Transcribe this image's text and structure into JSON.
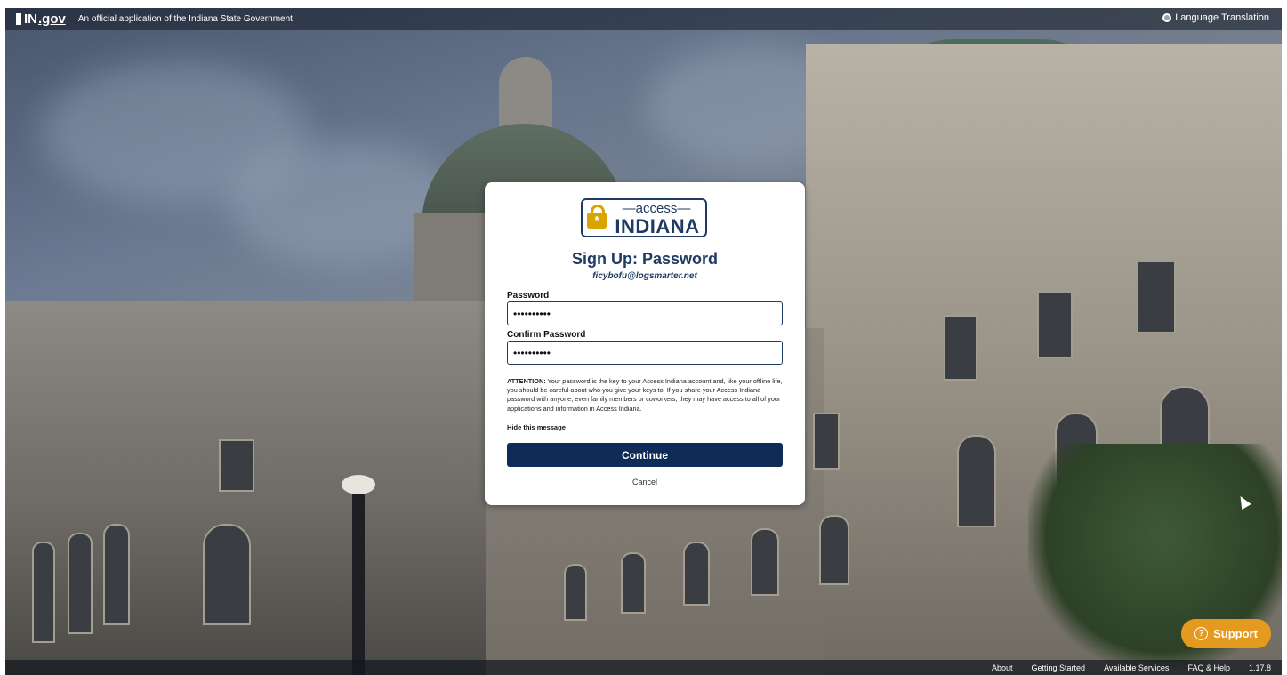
{
  "topbar": {
    "logo": "IN",
    "logo_gov": ".gov",
    "official_text": "An official application of the Indiana State Government",
    "language_label": "Language Translation",
    "language_icon": "globe-icon"
  },
  "card": {
    "brand_top": "—access—",
    "brand_bottom": "INDIANA",
    "brand_icon": "lock-icon",
    "title": "Sign Up: Password",
    "email": "ficybofu@logsmarter.net",
    "password_label": "Password",
    "password_value": "••••••••••",
    "confirm_label": "Confirm Password",
    "confirm_value": "••••••••••",
    "attention_prefix": "ATTENTION:",
    "attention_text": " Your password is the key to your Access Indiana account and, like your offline life, you should be careful about who you give your keys to. If you share your Access Indiana password with anyone, even family members or coworkers, they may have access to all of your applications and information in Access Indiana.",
    "hide_message": "Hide this message",
    "continue_label": "Continue",
    "cancel_label": "Cancel"
  },
  "support": {
    "label": "Support",
    "icon": "question-icon"
  },
  "footer": {
    "about": "About",
    "getting_started": "Getting Started",
    "available_services": "Available Services",
    "faq": "FAQ & Help",
    "version": "1.17.8"
  },
  "colors": {
    "brand_navy": "#1f3b63",
    "button_navy": "#0e2c55",
    "support_orange": "#e39a1f",
    "lock_gold": "#d9a400"
  }
}
